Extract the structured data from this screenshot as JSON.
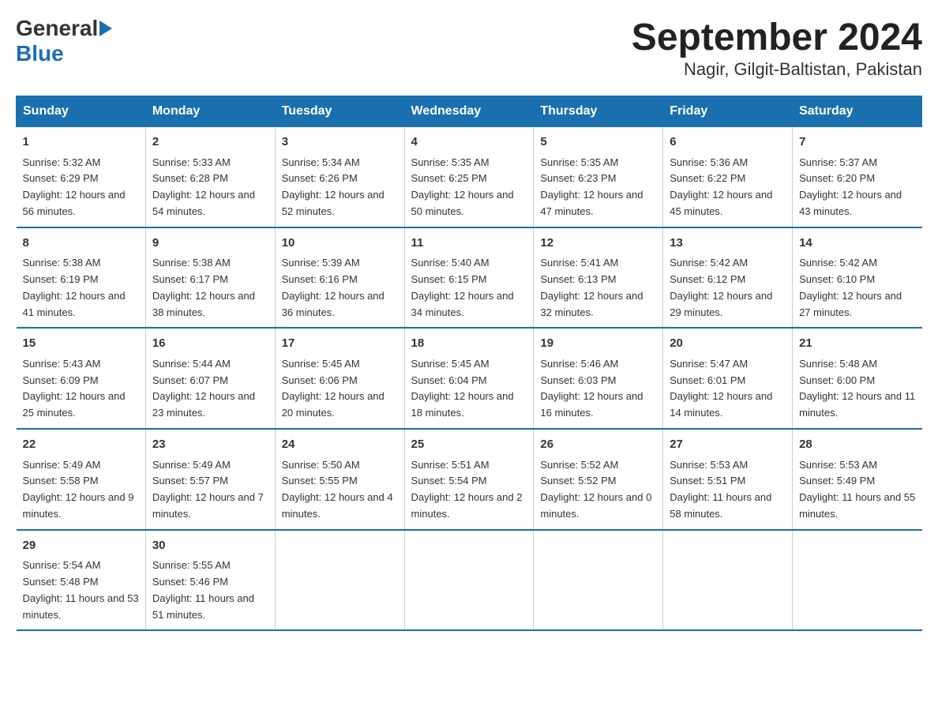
{
  "logo": {
    "general": "General",
    "blue": "Blue"
  },
  "title": {
    "month_year": "September 2024",
    "location": "Nagir, Gilgit-Baltistan, Pakistan"
  },
  "days_of_week": [
    "Sunday",
    "Monday",
    "Tuesday",
    "Wednesday",
    "Thursday",
    "Friday",
    "Saturday"
  ],
  "weeks": [
    [
      {
        "day": "1",
        "sunrise": "Sunrise: 5:32 AM",
        "sunset": "Sunset: 6:29 PM",
        "daylight": "Daylight: 12 hours and 56 minutes."
      },
      {
        "day": "2",
        "sunrise": "Sunrise: 5:33 AM",
        "sunset": "Sunset: 6:28 PM",
        "daylight": "Daylight: 12 hours and 54 minutes."
      },
      {
        "day": "3",
        "sunrise": "Sunrise: 5:34 AM",
        "sunset": "Sunset: 6:26 PM",
        "daylight": "Daylight: 12 hours and 52 minutes."
      },
      {
        "day": "4",
        "sunrise": "Sunrise: 5:35 AM",
        "sunset": "Sunset: 6:25 PM",
        "daylight": "Daylight: 12 hours and 50 minutes."
      },
      {
        "day": "5",
        "sunrise": "Sunrise: 5:35 AM",
        "sunset": "Sunset: 6:23 PM",
        "daylight": "Daylight: 12 hours and 47 minutes."
      },
      {
        "day": "6",
        "sunrise": "Sunrise: 5:36 AM",
        "sunset": "Sunset: 6:22 PM",
        "daylight": "Daylight: 12 hours and 45 minutes."
      },
      {
        "day": "7",
        "sunrise": "Sunrise: 5:37 AM",
        "sunset": "Sunset: 6:20 PM",
        "daylight": "Daylight: 12 hours and 43 minutes."
      }
    ],
    [
      {
        "day": "8",
        "sunrise": "Sunrise: 5:38 AM",
        "sunset": "Sunset: 6:19 PM",
        "daylight": "Daylight: 12 hours and 41 minutes."
      },
      {
        "day": "9",
        "sunrise": "Sunrise: 5:38 AM",
        "sunset": "Sunset: 6:17 PM",
        "daylight": "Daylight: 12 hours and 38 minutes."
      },
      {
        "day": "10",
        "sunrise": "Sunrise: 5:39 AM",
        "sunset": "Sunset: 6:16 PM",
        "daylight": "Daylight: 12 hours and 36 minutes."
      },
      {
        "day": "11",
        "sunrise": "Sunrise: 5:40 AM",
        "sunset": "Sunset: 6:15 PM",
        "daylight": "Daylight: 12 hours and 34 minutes."
      },
      {
        "day": "12",
        "sunrise": "Sunrise: 5:41 AM",
        "sunset": "Sunset: 6:13 PM",
        "daylight": "Daylight: 12 hours and 32 minutes."
      },
      {
        "day": "13",
        "sunrise": "Sunrise: 5:42 AM",
        "sunset": "Sunset: 6:12 PM",
        "daylight": "Daylight: 12 hours and 29 minutes."
      },
      {
        "day": "14",
        "sunrise": "Sunrise: 5:42 AM",
        "sunset": "Sunset: 6:10 PM",
        "daylight": "Daylight: 12 hours and 27 minutes."
      }
    ],
    [
      {
        "day": "15",
        "sunrise": "Sunrise: 5:43 AM",
        "sunset": "Sunset: 6:09 PM",
        "daylight": "Daylight: 12 hours and 25 minutes."
      },
      {
        "day": "16",
        "sunrise": "Sunrise: 5:44 AM",
        "sunset": "Sunset: 6:07 PM",
        "daylight": "Daylight: 12 hours and 23 minutes."
      },
      {
        "day": "17",
        "sunrise": "Sunrise: 5:45 AM",
        "sunset": "Sunset: 6:06 PM",
        "daylight": "Daylight: 12 hours and 20 minutes."
      },
      {
        "day": "18",
        "sunrise": "Sunrise: 5:45 AM",
        "sunset": "Sunset: 6:04 PM",
        "daylight": "Daylight: 12 hours and 18 minutes."
      },
      {
        "day": "19",
        "sunrise": "Sunrise: 5:46 AM",
        "sunset": "Sunset: 6:03 PM",
        "daylight": "Daylight: 12 hours and 16 minutes."
      },
      {
        "day": "20",
        "sunrise": "Sunrise: 5:47 AM",
        "sunset": "Sunset: 6:01 PM",
        "daylight": "Daylight: 12 hours and 14 minutes."
      },
      {
        "day": "21",
        "sunrise": "Sunrise: 5:48 AM",
        "sunset": "Sunset: 6:00 PM",
        "daylight": "Daylight: 12 hours and 11 minutes."
      }
    ],
    [
      {
        "day": "22",
        "sunrise": "Sunrise: 5:49 AM",
        "sunset": "Sunset: 5:58 PM",
        "daylight": "Daylight: 12 hours and 9 minutes."
      },
      {
        "day": "23",
        "sunrise": "Sunrise: 5:49 AM",
        "sunset": "Sunset: 5:57 PM",
        "daylight": "Daylight: 12 hours and 7 minutes."
      },
      {
        "day": "24",
        "sunrise": "Sunrise: 5:50 AM",
        "sunset": "Sunset: 5:55 PM",
        "daylight": "Daylight: 12 hours and 4 minutes."
      },
      {
        "day": "25",
        "sunrise": "Sunrise: 5:51 AM",
        "sunset": "Sunset: 5:54 PM",
        "daylight": "Daylight: 12 hours and 2 minutes."
      },
      {
        "day": "26",
        "sunrise": "Sunrise: 5:52 AM",
        "sunset": "Sunset: 5:52 PM",
        "daylight": "Daylight: 12 hours and 0 minutes."
      },
      {
        "day": "27",
        "sunrise": "Sunrise: 5:53 AM",
        "sunset": "Sunset: 5:51 PM",
        "daylight": "Daylight: 11 hours and 58 minutes."
      },
      {
        "day": "28",
        "sunrise": "Sunrise: 5:53 AM",
        "sunset": "Sunset: 5:49 PM",
        "daylight": "Daylight: 11 hours and 55 minutes."
      }
    ],
    [
      {
        "day": "29",
        "sunrise": "Sunrise: 5:54 AM",
        "sunset": "Sunset: 5:48 PM",
        "daylight": "Daylight: 11 hours and 53 minutes."
      },
      {
        "day": "30",
        "sunrise": "Sunrise: 5:55 AM",
        "sunset": "Sunset: 5:46 PM",
        "daylight": "Daylight: 11 hours and 51 minutes."
      },
      {
        "day": "",
        "sunrise": "",
        "sunset": "",
        "daylight": ""
      },
      {
        "day": "",
        "sunrise": "",
        "sunset": "",
        "daylight": ""
      },
      {
        "day": "",
        "sunrise": "",
        "sunset": "",
        "daylight": ""
      },
      {
        "day": "",
        "sunrise": "",
        "sunset": "",
        "daylight": ""
      },
      {
        "day": "",
        "sunrise": "",
        "sunset": "",
        "daylight": ""
      }
    ]
  ]
}
